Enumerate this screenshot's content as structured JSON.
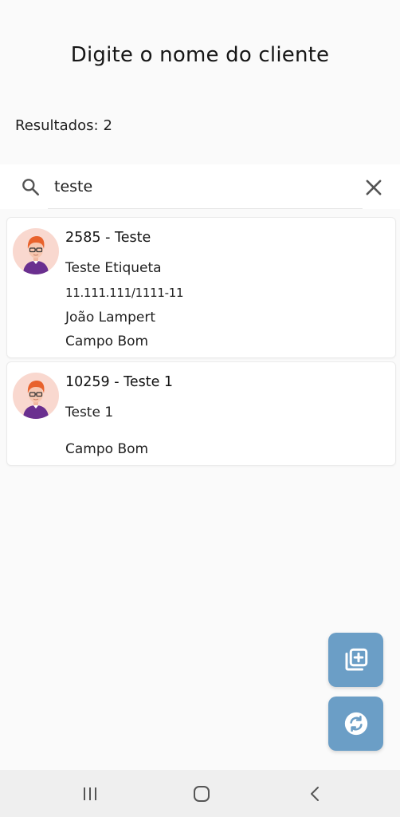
{
  "header": {
    "title": "Digite o nome do cliente"
  },
  "results": {
    "label": "Resultados:",
    "count": "2"
  },
  "search": {
    "value": "teste",
    "placeholder": ""
  },
  "clients": [
    {
      "title": "2585 - Teste",
      "name": "Teste Etiqueta",
      "document": "11.111.111/1111-11",
      "contact": "João Lampert",
      "city": "Campo Bom"
    },
    {
      "title": "10259 - Teste 1",
      "name": "Teste 1",
      "document": "",
      "contact": "",
      "city": "Campo Bom"
    }
  ],
  "fabs": {
    "add_icon": "add-copy-icon",
    "sync_icon": "sync-icon"
  },
  "colors": {
    "accent": "#6b9ec6",
    "avatar_bg": "#f9d8cf",
    "hair": "#e8622c",
    "shirt": "#6a2f8f"
  },
  "system_nav": {
    "recent_icon": "recent-apps-icon",
    "home_icon": "home-icon",
    "back_icon": "back-icon"
  }
}
